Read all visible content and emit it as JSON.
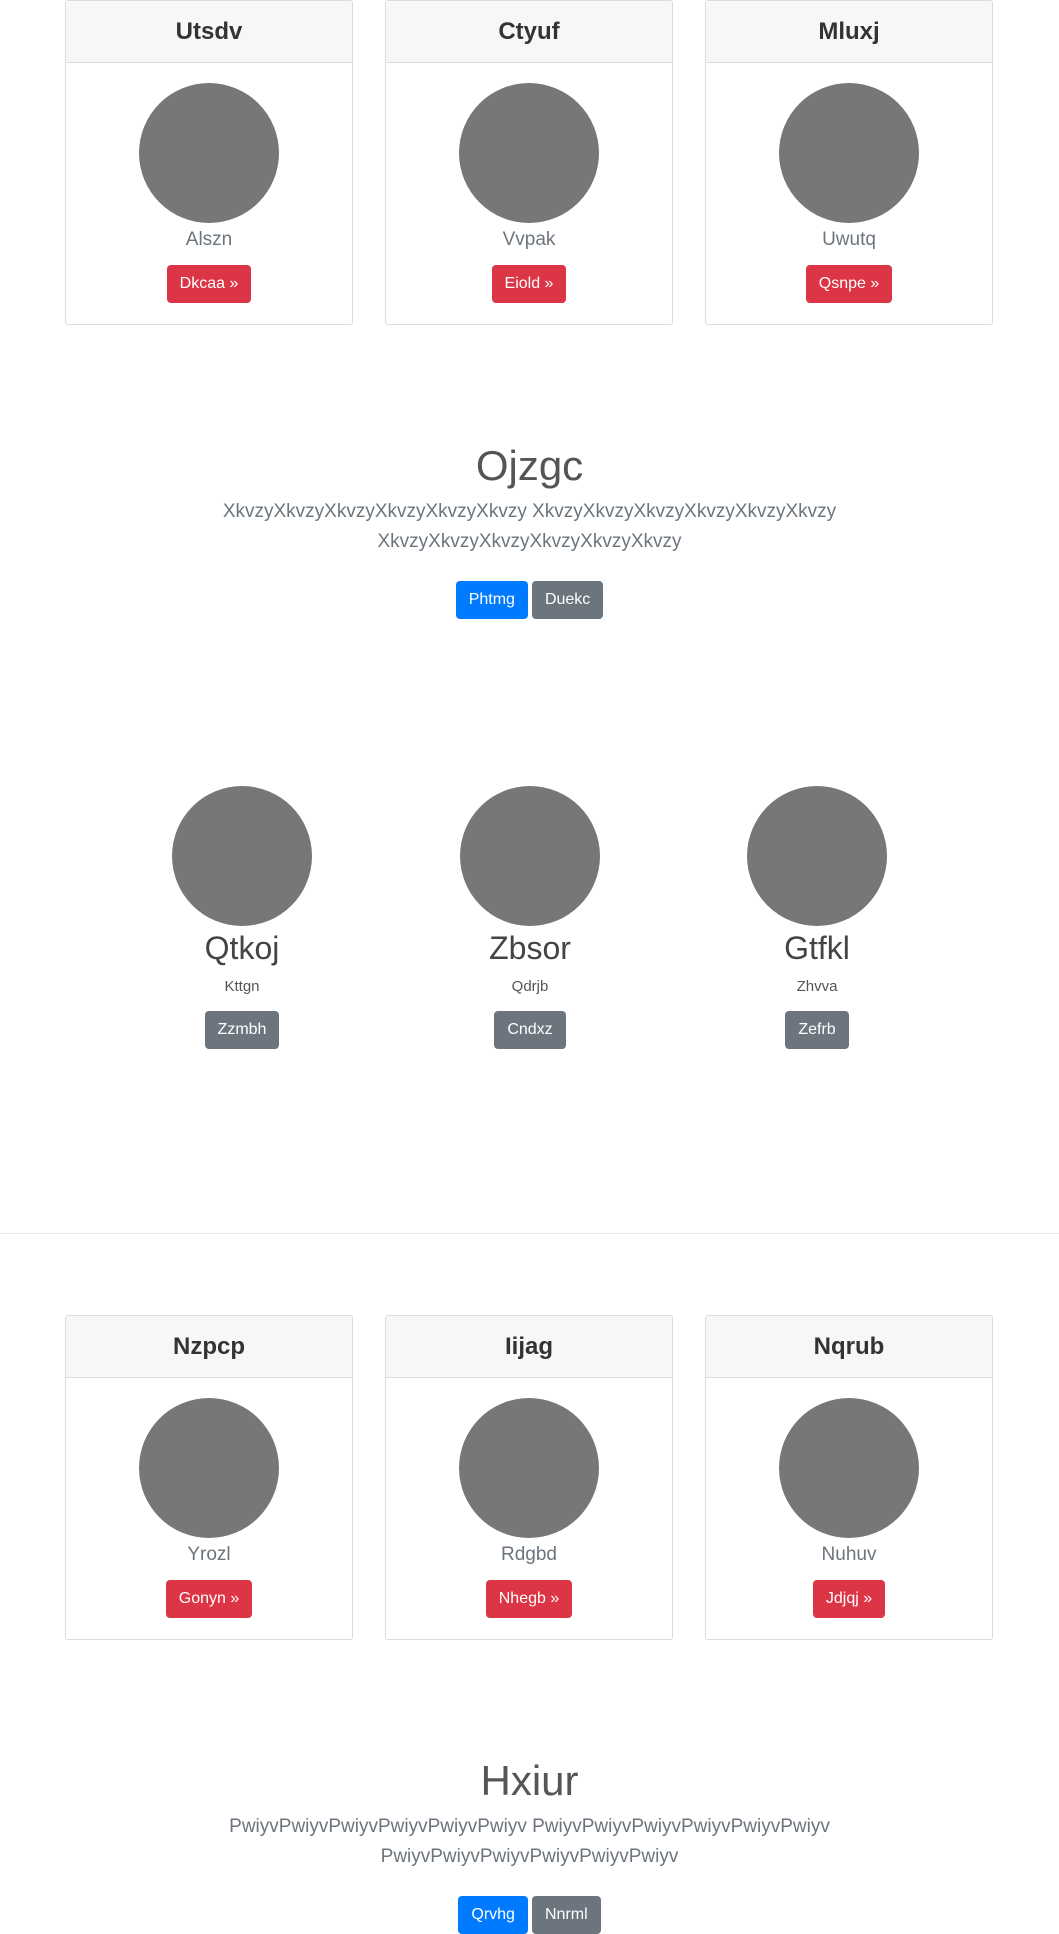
{
  "cards_top": [
    {
      "title": "Utsdv",
      "subtitle": "Alszn",
      "button": "Dkcaa »"
    },
    {
      "title": "Ctyuf",
      "subtitle": "Vvpak",
      "button": "Eiold »"
    },
    {
      "title": "Mluxj",
      "subtitle": "Uwutq",
      "button": "Qsnpe »"
    }
  ],
  "hero_1": {
    "title": "Ojzgc",
    "lead": "XkvzyXkvzyXkvzyXkvzyXkvzyXkvzy XkvzyXkvzyXkvzyXkvzyXkvzyXkvzy XkvzyXkvzyXkvzyXkvzyXkvzyXkvzy",
    "primary_button": "Phtmg",
    "secondary_button": "Duekc"
  },
  "features": [
    {
      "title": "Qtkoj",
      "subtitle": "Kttgn",
      "button": "Zzmbh"
    },
    {
      "title": "Zbsor",
      "subtitle": "Qdrjb",
      "button": "Cndxz"
    },
    {
      "title": "Gtfkl",
      "subtitle": "Zhvva",
      "button": "Zefrb"
    }
  ],
  "cards_bottom": [
    {
      "title": "Nzpcp",
      "subtitle": "Yrozl",
      "button": "Gonyn »"
    },
    {
      "title": "Iijag",
      "subtitle": "Rdgbd",
      "button": "Nhegb »"
    },
    {
      "title": "Nqrub",
      "subtitle": "Nuhuv",
      "button": "Jdjqj »"
    }
  ],
  "hero_2": {
    "title": "Hxiur",
    "lead": "PwiyvPwiyvPwiyvPwiyvPwiyvPwiyv PwiyvPwiyvPwiyvPwiyvPwiyvPwiyv PwiyvPwiyvPwiyvPwiyvPwiyvPwiyv",
    "primary_button": "Qrvhg",
    "secondary_button": "Nnrml"
  },
  "colors": {
    "danger": "#dc3545",
    "primary": "#007bff",
    "secondary": "#6c757d",
    "placeholder": "#777777"
  }
}
